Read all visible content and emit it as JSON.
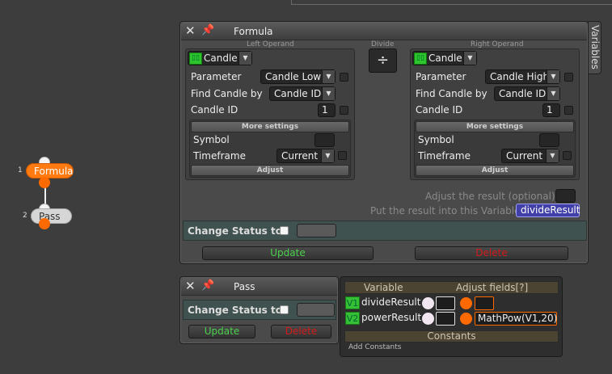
{
  "nodes": [
    {
      "num": "1",
      "label": "Formula"
    },
    {
      "num": "2",
      "label": "Pass"
    }
  ],
  "formula_panel": {
    "title": "Formula",
    "side_tab": "Variables",
    "left_operand_label": "Left Operand",
    "divide_label": "Divide",
    "divide_symbol": "÷",
    "right_operand_label": "Right Operand",
    "left": {
      "type": "Candle",
      "parameter_label": "Parameter",
      "parameter_value": "Candle Low",
      "find_by_label": "Find Candle by",
      "find_by_value": "Candle ID",
      "candle_id_label": "Candle ID",
      "candle_id_value": "1",
      "more_settings": "More settings",
      "symbol_label": "Symbol",
      "timeframe_label": "Timeframe",
      "timeframe_value": "Current",
      "adjust": "Adjust"
    },
    "right": {
      "type": "Candle",
      "parameter_label": "Parameter",
      "parameter_value": "Candle High",
      "find_by_label": "Find Candle by",
      "find_by_value": "Candle ID",
      "candle_id_label": "Candle ID",
      "candle_id_value": "1",
      "more_settings": "More settings",
      "symbol_label": "Symbol",
      "timeframe_label": "Timeframe",
      "timeframe_value": "Current",
      "adjust": "Adjust"
    },
    "adjust_result_label": "Adjust the result (optional):",
    "put_result_label": "Put the result into this Variable:",
    "result_variable": "divideResult",
    "change_status_label": "Change Status to",
    "update_label": "Update",
    "delete_label": "Delete"
  },
  "pass_panel": {
    "title": "Pass",
    "change_status_label": "Change Status to",
    "update_label": "Update",
    "delete_label": "Delete"
  },
  "variables_panel": {
    "col_variable": "Variable",
    "col_adjust": "Adjust fields[?]",
    "rows": [
      {
        "badge": "V1",
        "name": "divideResult",
        "adjust": ""
      },
      {
        "badge": "V2",
        "name": "powerResult",
        "adjust": "MathPow(V1,20)"
      }
    ],
    "constants_label": "Constants",
    "add_constants_label": "Add Constants"
  },
  "colors": {
    "accent_orange": "#ff6a00",
    "update_green": "#4bd14b",
    "delete_red": "#d41a1a",
    "variable_chip": "#4040a8"
  }
}
